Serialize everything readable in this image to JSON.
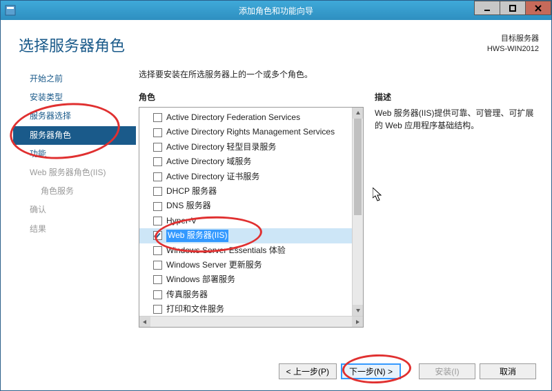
{
  "window": {
    "title": "添加角色和功能向导"
  },
  "page_title": "选择服务器角色",
  "target": {
    "label": "目标服务器",
    "server": "HWS-WIN2012"
  },
  "sidebar": {
    "items": [
      {
        "label": "开始之前",
        "selected": false,
        "disabled": false
      },
      {
        "label": "安装类型",
        "selected": false,
        "disabled": false
      },
      {
        "label": "服务器选择",
        "selected": false,
        "disabled": false
      },
      {
        "label": "服务器角色",
        "selected": true,
        "disabled": false
      },
      {
        "label": "功能",
        "selected": false,
        "disabled": false
      },
      {
        "label": "Web 服务器角色(IIS)",
        "selected": false,
        "disabled": true
      },
      {
        "label": "角色服务",
        "selected": false,
        "disabled": true,
        "sub": true
      },
      {
        "label": "确认",
        "selected": false,
        "disabled": true
      },
      {
        "label": "结果",
        "selected": false,
        "disabled": true
      }
    ]
  },
  "instruction": "选择要安装在所选服务器上的一个或多个角色。",
  "roles_header": "角色",
  "desc_header": "描述",
  "roles": [
    {
      "label": "Active Directory Federation Services",
      "checked": false
    },
    {
      "label": "Active Directory Rights Management Services",
      "checked": false
    },
    {
      "label": "Active Directory 轻型目录服务",
      "checked": false
    },
    {
      "label": "Active Directory 域服务",
      "checked": false
    },
    {
      "label": "Active Directory 证书服务",
      "checked": false
    },
    {
      "label": "DHCP 服务器",
      "checked": false
    },
    {
      "label": "DNS 服务器",
      "checked": false
    },
    {
      "label": "Hyper-V",
      "checked": false
    },
    {
      "label": "Web 服务器(IIS)",
      "checked": true,
      "highlight": true
    },
    {
      "label": "Windows Server Essentials 体验",
      "checked": false
    },
    {
      "label": "Windows Server 更新服务",
      "checked": false
    },
    {
      "label": "Windows 部署服务",
      "checked": false
    },
    {
      "label": "传真服务器",
      "checked": false
    },
    {
      "label": "打印和文件服务",
      "checked": false
    }
  ],
  "description": "Web 服务器(IIS)提供可靠、可管理、可扩展的 Web 应用程序基础结构。",
  "buttons": {
    "prev": "< 上一步(P)",
    "next": "下一步(N) >",
    "install": "安装(I)",
    "cancel": "取消"
  }
}
